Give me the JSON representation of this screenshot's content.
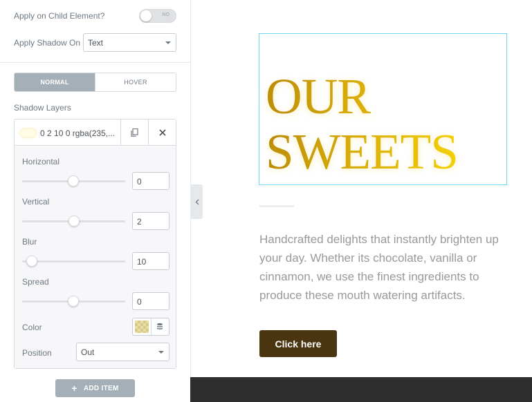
{
  "panel": {
    "apply_child_label": "Apply on Child Element?",
    "apply_child_toggle": "NO",
    "apply_shadow_label": "Apply Shadow On",
    "apply_shadow_value": "Text",
    "tabs": {
      "normal": "NORMAL",
      "hover": "HOVER"
    },
    "shadow_layers_label": "Shadow Layers",
    "layer": {
      "title": "0 2 10 0 rgba(235,...",
      "horizontal": {
        "label": "Horizontal",
        "value": "0"
      },
      "vertical": {
        "label": "Vertical",
        "value": "2"
      },
      "blur": {
        "label": "Blur",
        "value": "10"
      },
      "spread": {
        "label": "Spread",
        "value": "0"
      },
      "color_label": "Color",
      "position_label": "Position",
      "position_value": "Out"
    },
    "add_item": "ADD ITEM"
  },
  "canvas": {
    "headline_line1": "OUR",
    "headline_line2": "SWEETS",
    "paragraph": "Handcrafted delights that instantly brighten up your day. Whether its chocolate, vanilla or cinnamon, we use the finest ingredients to produce these mouth watering artifacts.",
    "cta": "Click here"
  },
  "colors": {
    "accent_gray": "#a4afb7",
    "cta_brown": "#4a3510",
    "headline_gold": "#d6a90b",
    "footer_dark": "#2e2e2e"
  }
}
